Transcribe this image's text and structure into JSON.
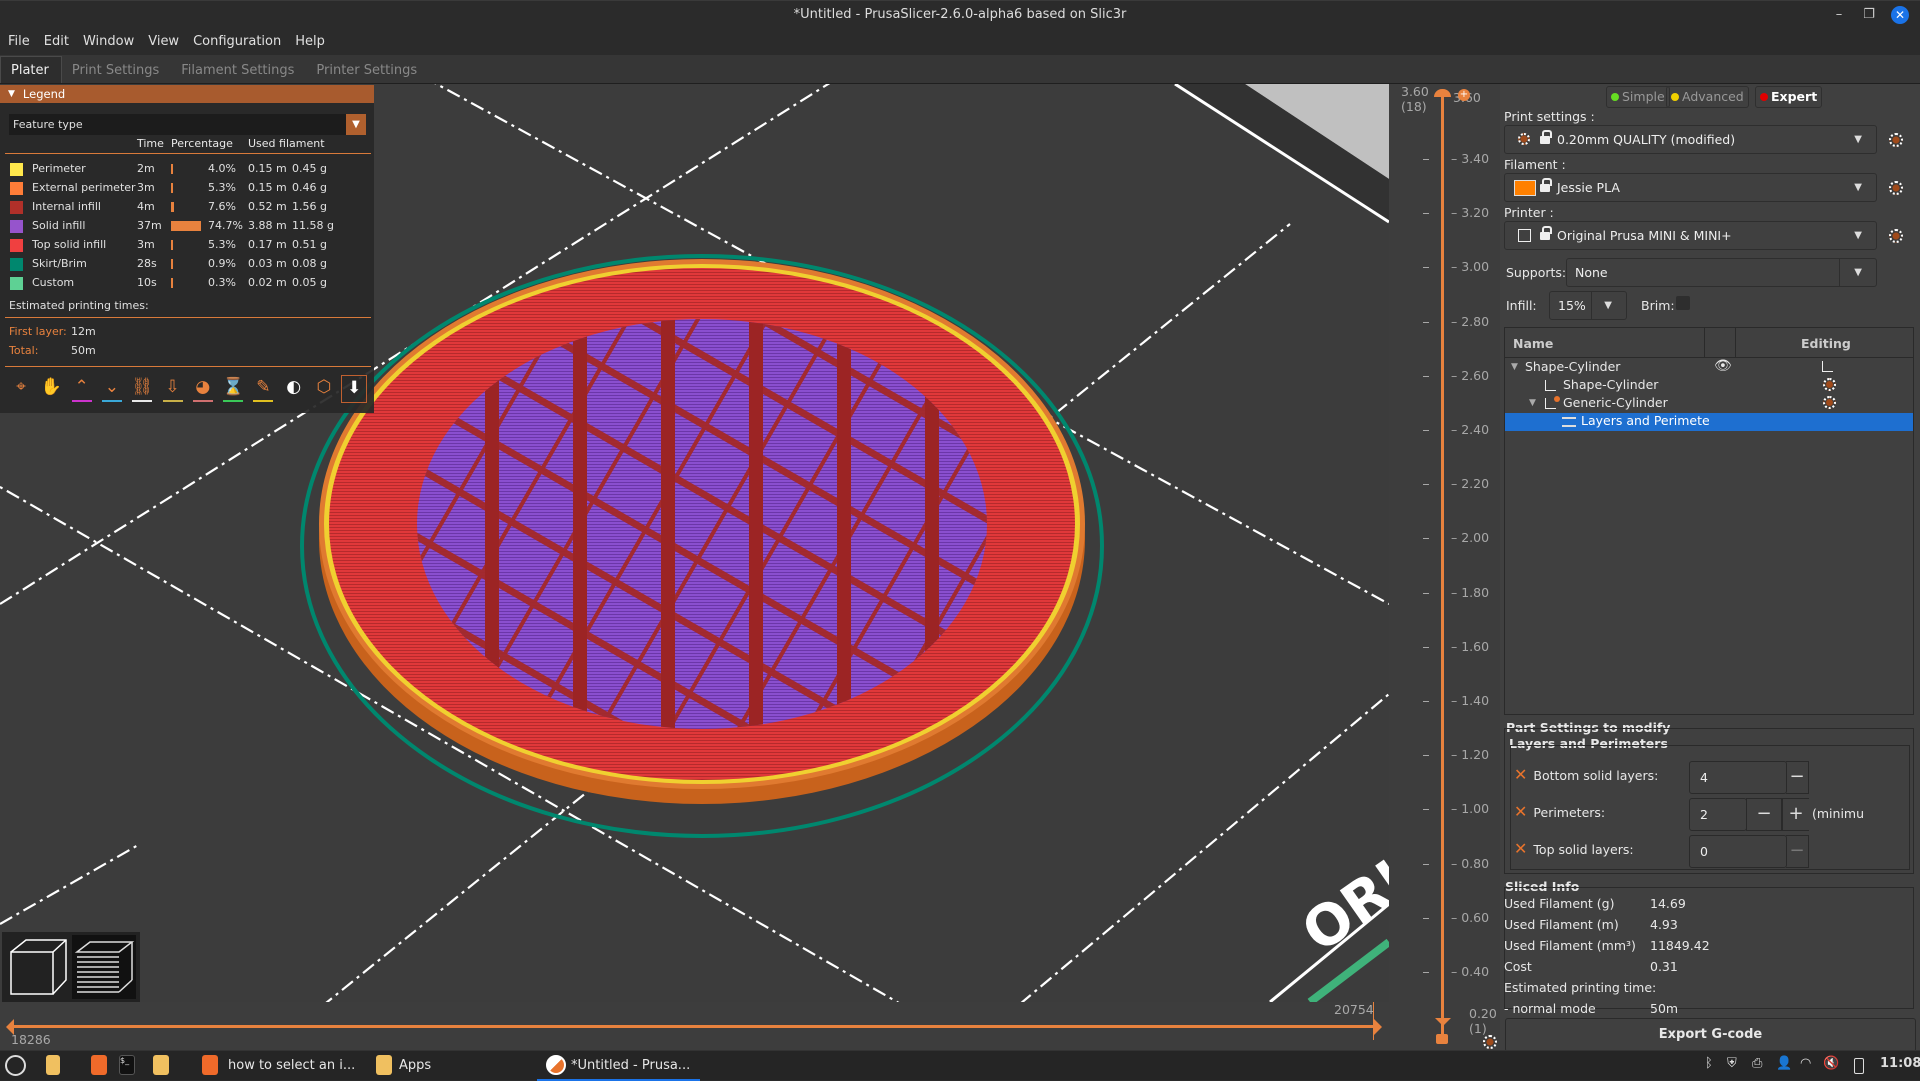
{
  "window": {
    "title": "*Untitled - PrusaSlicer-2.6.0-alpha6 based on Slic3r",
    "minimize": "–",
    "maximize": "❐",
    "close": "✕"
  },
  "menu": [
    "File",
    "Edit",
    "Window",
    "View",
    "Configuration",
    "Help"
  ],
  "tabs": [
    {
      "label": "Plater",
      "active": true
    },
    {
      "label": "Print Settings",
      "active": false
    },
    {
      "label": "Filament Settings",
      "active": false
    },
    {
      "label": "Printer Settings",
      "active": false
    }
  ],
  "legend": {
    "title": "Legend",
    "view_type": "Feature type",
    "columns": {
      "time": "Time",
      "percentage": "Percentage",
      "used_filament": "Used filament"
    },
    "rows": [
      {
        "name": "Perimeter",
        "color": "#ffe84c",
        "time": "2m",
        "percent": "4.0%",
        "pct_value": 4.0,
        "length": "0.15 m",
        "weight": "0.45 g"
      },
      {
        "name": "External perimeter",
        "color": "#ff7d38",
        "time": "3m",
        "percent": "5.3%",
        "pct_value": 5.3,
        "length": "0.15 m",
        "weight": "0.46 g"
      },
      {
        "name": "Internal infill",
        "color": "#b03029",
        "time": "4m",
        "percent": "7.6%",
        "pct_value": 7.6,
        "length": "0.52 m",
        "weight": "1.56 g"
      },
      {
        "name": "Solid infill",
        "color": "#9654cc",
        "time": "37m",
        "percent": "74.7%",
        "pct_value": 74.7,
        "length": "3.88 m",
        "weight": "11.58 g"
      },
      {
        "name": "Top solid infill",
        "color": "#f04040",
        "time": "3m",
        "percent": "5.3%",
        "pct_value": 5.3,
        "length": "0.17 m",
        "weight": "0.51 g"
      },
      {
        "name": "Skirt/Brim",
        "color": "#00876e",
        "time": "28s",
        "percent": "0.9%",
        "pct_value": 0.9,
        "length": "0.03 m",
        "weight": "0.08 g"
      },
      {
        "name": "Custom",
        "color": "#5ed194",
        "time": "10s",
        "percent": "0.3%",
        "pct_value": 0.3,
        "length": "0.02 m",
        "weight": "0.05 g"
      }
    ],
    "estimated_label": "Estimated printing times:",
    "first_layer_label": "First layer:",
    "first_layer_value": "12m",
    "total_label": "Total:",
    "total_value": "50m",
    "tools": [
      {
        "name": "travel-icon",
        "glyph": "⌖",
        "underline": ""
      },
      {
        "name": "wipe-icon",
        "glyph": "✋",
        "underline": ""
      },
      {
        "name": "retractions-icon",
        "glyph": "⌃",
        "underline": "#cc33cc"
      },
      {
        "name": "deretractions-icon",
        "glyph": "⌄",
        "underline": "#3aa8d8"
      },
      {
        "name": "seams-icon",
        "glyph": "⛓",
        "underline": "#e8e8e8"
      },
      {
        "name": "tool-changes-icon",
        "glyph": "⇩",
        "underline": "#c8b048"
      },
      {
        "name": "color-changes-icon",
        "glyph": "◕",
        "underline": "#d07070"
      },
      {
        "name": "pause-prints-icon",
        "glyph": "⌛",
        "underline": "#3ac858"
      },
      {
        "name": "custom-gcodes-icon",
        "glyph": "✎",
        "underline": "#e0c020"
      },
      {
        "name": "center-of-gravity-icon",
        "glyph": "◐",
        "underline": ""
      },
      {
        "name": "shells-icon",
        "glyph": "⬡",
        "underline": ""
      },
      {
        "name": "tool-marker-icon",
        "glyph": "⬇",
        "underline": ""
      }
    ]
  },
  "vertical_slider": {
    "top_value": "3.60",
    "top_layer": "(18)",
    "top_label": "3.60",
    "ticks": [
      "3.40",
      "3.20",
      "3.00",
      "2.80",
      "2.60",
      "2.40",
      "2.20",
      "2.00",
      "1.80",
      "1.60",
      "1.40",
      "1.20",
      "1.00",
      "0.80",
      "0.60",
      "0.40"
    ],
    "bottom_value": "0.20",
    "bottom_layer": "(1)"
  },
  "horizontal_slider": {
    "left_value": "18286",
    "right_value": "20754"
  },
  "bed_label": "ORI",
  "right_panel": {
    "modes": [
      {
        "label": "Simple",
        "color": "#66dd22",
        "active": false
      },
      {
        "label": "Advanced",
        "color": "#f0d000",
        "active": false
      },
      {
        "label": "Expert",
        "color": "#e00000",
        "active": true
      }
    ],
    "print_settings_label": "Print settings :",
    "print_settings_value": "0.20mm QUALITY (modified)",
    "filament_label": "Filament :",
    "filament_value": "Jessie PLA",
    "filament_color": "#ff8000",
    "printer_label": "Printer :",
    "printer_value": "Original Prusa MINI & MINI+",
    "supports_label": "Supports:",
    "supports_value": "None",
    "infill_label": "Infill:",
    "infill_value": "15%",
    "brim_label": "Brim:",
    "brim_checked": false,
    "object_list": {
      "col_name": "Name",
      "col_editing": "Editing",
      "rows": [
        {
          "label": "Shape-Cylinder",
          "level": 0,
          "expanded": true,
          "selected": false
        },
        {
          "label": "Shape-Cylinder",
          "level": 1,
          "selected": false
        },
        {
          "label": "Generic-Cylinder",
          "level": 1,
          "expanded": true,
          "selected": false
        },
        {
          "label": "Layers and Perimete",
          "level": 2,
          "selected": true
        }
      ]
    },
    "part_settings": {
      "title": "Part Settings to modify",
      "group": "Layers and Perimeters",
      "rows": [
        {
          "label": "Bottom solid layers:",
          "value": "4"
        },
        {
          "label": "Perimeters:",
          "value": "2",
          "note": "(minimu"
        },
        {
          "label": "Top solid layers:",
          "value": "0"
        }
      ]
    },
    "sliced_info": {
      "title": "Sliced Info",
      "rows": [
        {
          "label": "Used Filament (g)",
          "value": "14.69"
        },
        {
          "label": "Used Filament (m)",
          "value": "4.93"
        },
        {
          "label": "Used Filament (mm³)",
          "value": "11849.42"
        },
        {
          "label": "Cost",
          "value": "0.31"
        },
        {
          "label": "Estimated printing time:",
          "value": ""
        },
        {
          "label": " - normal mode",
          "value": "50m"
        }
      ]
    },
    "export_label": "Export G-code"
  },
  "taskbar": {
    "items": [
      {
        "label": "how to select an i..."
      },
      {
        "label": "Apps"
      },
      {
        "label": "*Untitled - Prusa..."
      }
    ],
    "clock": "11:08"
  }
}
